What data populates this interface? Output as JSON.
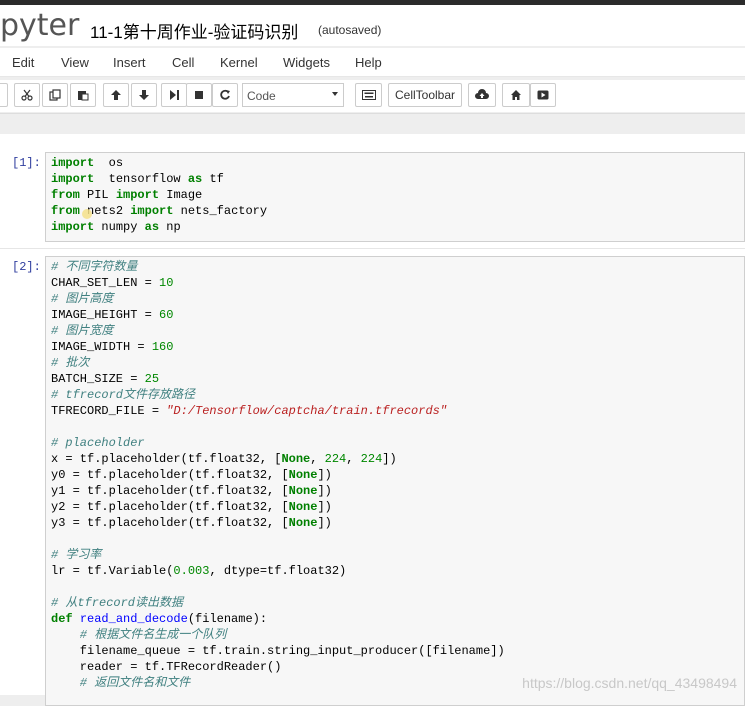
{
  "header": {
    "logo": "pyter",
    "notebook_title": "11-1第十周作业-验证码识别",
    "save_status": "(autosaved)"
  },
  "menu": [
    "Edit",
    "View",
    "Insert",
    "Cell",
    "Kernel",
    "Widgets",
    "Help"
  ],
  "toolbar": {
    "cell_type": "Code",
    "celltoolbar_label": "CellToolbar",
    "icons": [
      "cut-icon",
      "copy-icon",
      "paste-icon",
      "move-up-icon",
      "move-down-icon",
      "run-icon",
      "stop-icon",
      "restart-icon",
      "keyboard-icon",
      "upload-icon",
      "home-icon",
      "presentation-icon"
    ]
  },
  "cells": [
    {
      "prompt": "[1]:",
      "lines": [
        [
          [
            "kw",
            "import"
          ],
          [
            "",
            "  os"
          ]
        ],
        [
          [
            "kw",
            "import"
          ],
          [
            "",
            "  tensorflow "
          ],
          [
            "kw",
            "as"
          ],
          [
            "",
            " tf"
          ]
        ],
        [
          [
            "kw",
            "from"
          ],
          [
            "",
            " PIL "
          ],
          [
            "kw",
            "import"
          ],
          [
            "",
            " Image"
          ]
        ],
        [
          [
            "kw",
            "from"
          ],
          [
            "",
            " nets2 "
          ],
          [
            "kw",
            "import"
          ],
          [
            "",
            " nets_factory"
          ]
        ],
        [
          [
            "kw",
            "import"
          ],
          [
            "",
            " numpy "
          ],
          [
            "kw",
            "as"
          ],
          [
            "",
            " np"
          ]
        ]
      ]
    },
    {
      "prompt": "[2]:",
      "lines": [
        [
          [
            "cmt",
            "# 不同字符数量"
          ]
        ],
        [
          [
            "",
            "CHAR_SET_LEN = "
          ],
          [
            "num",
            "10"
          ]
        ],
        [
          [
            "cmt",
            "# 图片高度"
          ]
        ],
        [
          [
            "",
            "IMAGE_HEIGHT = "
          ],
          [
            "num",
            "60"
          ]
        ],
        [
          [
            "cmt",
            "# 图片宽度"
          ]
        ],
        [
          [
            "",
            "IMAGE_WIDTH = "
          ],
          [
            "num",
            "160"
          ]
        ],
        [
          [
            "cmt",
            "# 批次"
          ]
        ],
        [
          [
            "",
            "BATCH_SIZE = "
          ],
          [
            "num",
            "25"
          ]
        ],
        [
          [
            "cmt",
            "# tfrecord文件存放路径"
          ]
        ],
        [
          [
            "",
            "TFRECORD_FILE = "
          ],
          [
            "str",
            "\"D:/Tensorflow/captcha/train.tfrecords\""
          ]
        ],
        [
          [
            "",
            ""
          ]
        ],
        [
          [
            "cmt",
            "# placeholder"
          ]
        ],
        [
          [
            "",
            "x = tf.placeholder(tf.float32, ["
          ],
          [
            "kw",
            "None"
          ],
          [
            "",
            ", "
          ],
          [
            "num",
            "224"
          ],
          [
            "",
            ", "
          ],
          [
            "num",
            "224"
          ],
          [
            "",
            "])"
          ]
        ],
        [
          [
            "",
            "y0 = tf.placeholder(tf.float32, ["
          ],
          [
            "kw",
            "None"
          ],
          [
            "",
            "])"
          ]
        ],
        [
          [
            "",
            "y1 = tf.placeholder(tf.float32, ["
          ],
          [
            "kw",
            "None"
          ],
          [
            "",
            "])"
          ]
        ],
        [
          [
            "",
            "y2 = tf.placeholder(tf.float32, ["
          ],
          [
            "kw",
            "None"
          ],
          [
            "",
            "])"
          ]
        ],
        [
          [
            "",
            "y3 = tf.placeholder(tf.float32, ["
          ],
          [
            "kw",
            "None"
          ],
          [
            "",
            "])"
          ]
        ],
        [
          [
            "",
            ""
          ]
        ],
        [
          [
            "cmt",
            "# 学习率"
          ]
        ],
        [
          [
            "",
            "lr = tf.Variable("
          ],
          [
            "num",
            "0.003"
          ],
          [
            "",
            ", dtype=tf.float32)"
          ]
        ],
        [
          [
            "",
            ""
          ]
        ],
        [
          [
            "cmt",
            "# 从tfrecord读出数据"
          ]
        ],
        [
          [
            "kw",
            "def"
          ],
          [
            "",
            " "
          ],
          [
            "fn",
            "read_and_decode"
          ],
          [
            "",
            "(filename):"
          ]
        ],
        [
          [
            "cmt",
            "    # 根据文件名生成一个队列"
          ]
        ],
        [
          [
            "",
            "    filename_queue = tf.train.string_input_producer([filename])"
          ]
        ],
        [
          [
            "",
            "    reader = tf.TFRecordReader()"
          ]
        ],
        [
          [
            "cmt",
            "    # 返回文件名和文件"
          ]
        ]
      ]
    }
  ],
  "watermark": "https://blog.csdn.net/qq_43498494"
}
